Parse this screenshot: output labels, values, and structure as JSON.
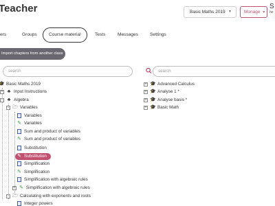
{
  "app": {
    "title": "Teacher"
  },
  "header": {
    "class_select_value": "Basic Maths 2019",
    "manage_label": "Monage",
    "user_initial": "S",
    "user_sub": "he"
  },
  "nav": {
    "tabs": [
      {
        "label": "Users"
      },
      {
        "label": "Groups"
      },
      {
        "label": "Course material"
      },
      {
        "label": "Tests"
      },
      {
        "label": "Messages"
      },
      {
        "label": "Settings"
      }
    ]
  },
  "import_button": "Import chapters from another class",
  "left_panel": {
    "search_placeholder": "search",
    "rows": [
      {
        "label": "Basic Maths 2019"
      },
      {
        "label": "Input Instructions"
      },
      {
        "label": "Algebra"
      },
      {
        "label": "Variables"
      },
      {
        "label": "Variables"
      },
      {
        "label": "Variables"
      },
      {
        "label": "Sum and product of variables"
      },
      {
        "label": "Sum and product of variables"
      },
      {
        "label": "Substitution"
      },
      {
        "label": "Substitution"
      },
      {
        "label": "Simplification"
      },
      {
        "label": "Simplification"
      },
      {
        "label": "Simplification with algebraic rules"
      },
      {
        "label": "Simplification with algebraic rules"
      },
      {
        "label": "Calculating with exponents and roots"
      },
      {
        "label": "Integer powers"
      }
    ]
  },
  "right_panel": {
    "search_placeholder": "search",
    "rows": [
      {
        "label": "Advanced Calculus"
      },
      {
        "label": "Analyse 1 *"
      },
      {
        "label": "Analyse basis *"
      },
      {
        "label": "Basic Math"
      }
    ]
  },
  "colors": {
    "accent": "#c2506f",
    "import_button_bg": "#6b6770",
    "pencil_green": "#2e9a3d",
    "page_blue": "#3b5bcc"
  }
}
